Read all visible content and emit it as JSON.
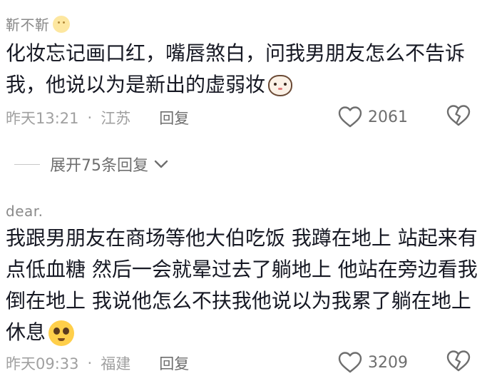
{
  "comments": [
    {
      "username": "靳不靳",
      "username_emoji": "slight-smile-emoji",
      "text": "化妆忘记画口红，嘴唇煞白，问我男朋友怎么不告诉我，他说以为是新出的虚弱妆",
      "text_emoji": "cat-face-emoji",
      "time": "昨天13:21",
      "location": "江苏",
      "reply_label": "回复",
      "like_count": "2061",
      "expand_label": "展开75条回复"
    },
    {
      "username": "dear.",
      "text": "我跟男朋友在商场等他大伯吃饭 我蹲在地上 站起来有点低血糖 然后一会就晕过去了躺地上 他站在旁边看我倒在地上 我说他怎么不扶我他说以为我累了躺在地上休息",
      "text_emoji": "pleading-face-emoji",
      "time": "昨天09:33",
      "location": "福建",
      "reply_label": "回复",
      "like_count": "3209"
    }
  ],
  "separator_dot": "·",
  "colors": {
    "text": "#161823",
    "meta": "#a0a0a0",
    "secondary": "#6e6e6e"
  }
}
